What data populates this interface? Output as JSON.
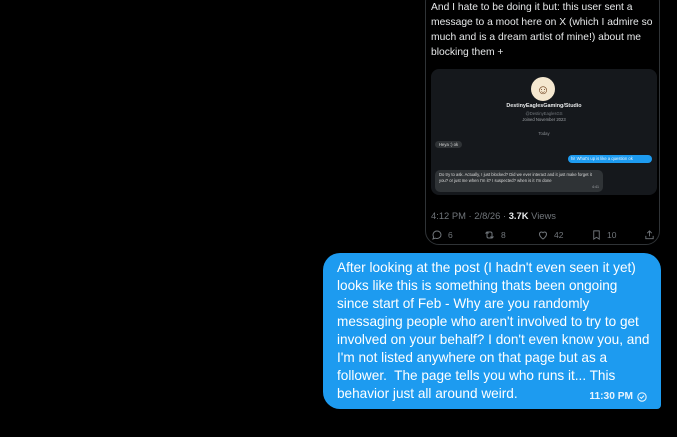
{
  "quoted_post": {
    "text": "And I hate to be doing it but: this user sent a message to a moot here on X (which I admire so much and is a dream artist of mine!) about me blocking them +",
    "image": {
      "avatar_glyph": "☺",
      "name": "DestinyEaglesGaming/Studio",
      "handle": "@DestinyEaglesGS",
      "joined": "Joined November 2023",
      "date": "Today",
      "small_message": "Heya :) ok",
      "sent_message": "hi! What's up is like a question ok",
      "received_message": "Do try to ask. Actually, I just blocked? Did we ever interact and it just make forget it you? or just me when I'm it? I suspected? when is it I'm done",
      "received_time": "4:41"
    },
    "time": "4:12 PM",
    "separator": "·",
    "date": "2/8/26",
    "views_count": "3.7K",
    "views_label": "Views",
    "stats": {
      "replies": "6",
      "reposts": "8",
      "likes": "42",
      "bookmarks": "10"
    }
  },
  "message": {
    "text": "After looking at the post (I hadn't even seen it yet) looks like this is something thats been ongoing since start of Feb - Why are you randomly messaging people who aren't involved to try to get involved on your behalf? I don't even know you, and I'm not listed anywhere on that page but as a follower.  The page tells you who runs it... This behavior just all around weird.",
    "time": "11:30 PM",
    "status_icon": "seen-check-icon"
  },
  "colors": {
    "background": "#000000",
    "bubble": "#1d9bf0",
    "muted": "#71767b",
    "border": "#2f3336"
  }
}
